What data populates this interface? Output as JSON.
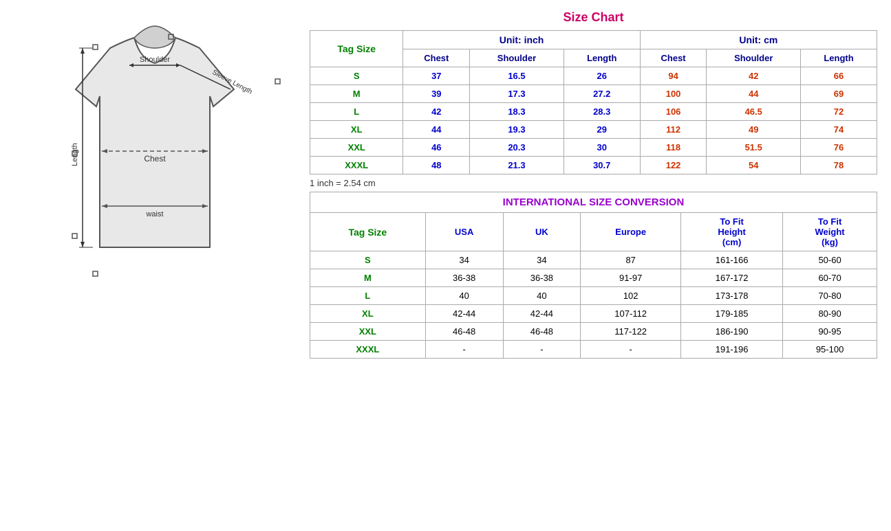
{
  "sizeChart": {
    "title": "Size Chart",
    "unitInch": "Unit: inch",
    "unitCm": "Unit: cm",
    "tagSizeLabel": "Tag Size",
    "inchNote": "1 inch = 2.54 cm",
    "colHeaders": [
      "Chest",
      "Shoulder",
      "Length",
      "Chest",
      "Shoulder",
      "Length"
    ],
    "rows": [
      {
        "size": "S",
        "chest_in": "37",
        "shoulder_in": "16.5",
        "length_in": "26",
        "chest_cm": "94",
        "shoulder_cm": "42",
        "length_cm": "66"
      },
      {
        "size": "M",
        "chest_in": "39",
        "shoulder_in": "17.3",
        "length_in": "27.2",
        "chest_cm": "100",
        "shoulder_cm": "44",
        "length_cm": "69"
      },
      {
        "size": "L",
        "chest_in": "42",
        "shoulder_in": "18.3",
        "length_in": "28.3",
        "chest_cm": "106",
        "shoulder_cm": "46.5",
        "length_cm": "72"
      },
      {
        "size": "XL",
        "chest_in": "44",
        "shoulder_in": "19.3",
        "length_in": "29",
        "chest_cm": "112",
        "shoulder_cm": "49",
        "length_cm": "74"
      },
      {
        "size": "XXL",
        "chest_in": "46",
        "shoulder_in": "20.3",
        "length_in": "30",
        "chest_cm": "118",
        "shoulder_cm": "51.5",
        "length_cm": "76"
      },
      {
        "size": "XXXL",
        "chest_in": "48",
        "shoulder_in": "21.3",
        "length_in": "30.7",
        "chest_cm": "122",
        "shoulder_cm": "54",
        "length_cm": "78"
      }
    ]
  },
  "conversion": {
    "title": "INTERNATIONAL SIZE CONVERSION",
    "tagSizeLabel": "Tag Size",
    "colHeaders": [
      "USA",
      "UK",
      "Europe",
      "To Fit Height (cm)",
      "To Fit Weight (kg)"
    ],
    "rows": [
      {
        "size": "S",
        "usa": "34",
        "uk": "34",
        "europe": "87",
        "height": "161-166",
        "weight": "50-60"
      },
      {
        "size": "M",
        "usa": "36-38",
        "uk": "36-38",
        "europe": "91-97",
        "height": "167-172",
        "weight": "60-70"
      },
      {
        "size": "L",
        "usa": "40",
        "uk": "40",
        "europe": "102",
        "height": "173-178",
        "weight": "70-80"
      },
      {
        "size": "XL",
        "usa": "42-44",
        "uk": "42-44",
        "europe": "107-112",
        "height": "179-185",
        "weight": "80-90"
      },
      {
        "size": "XXL",
        "usa": "46-48",
        "uk": "46-48",
        "europe": "117-122",
        "height": "186-190",
        "weight": "90-95"
      },
      {
        "size": "XXXL",
        "usa": "-",
        "uk": "-",
        "europe": "-",
        "height": "191-196",
        "weight": "95-100"
      }
    ]
  }
}
